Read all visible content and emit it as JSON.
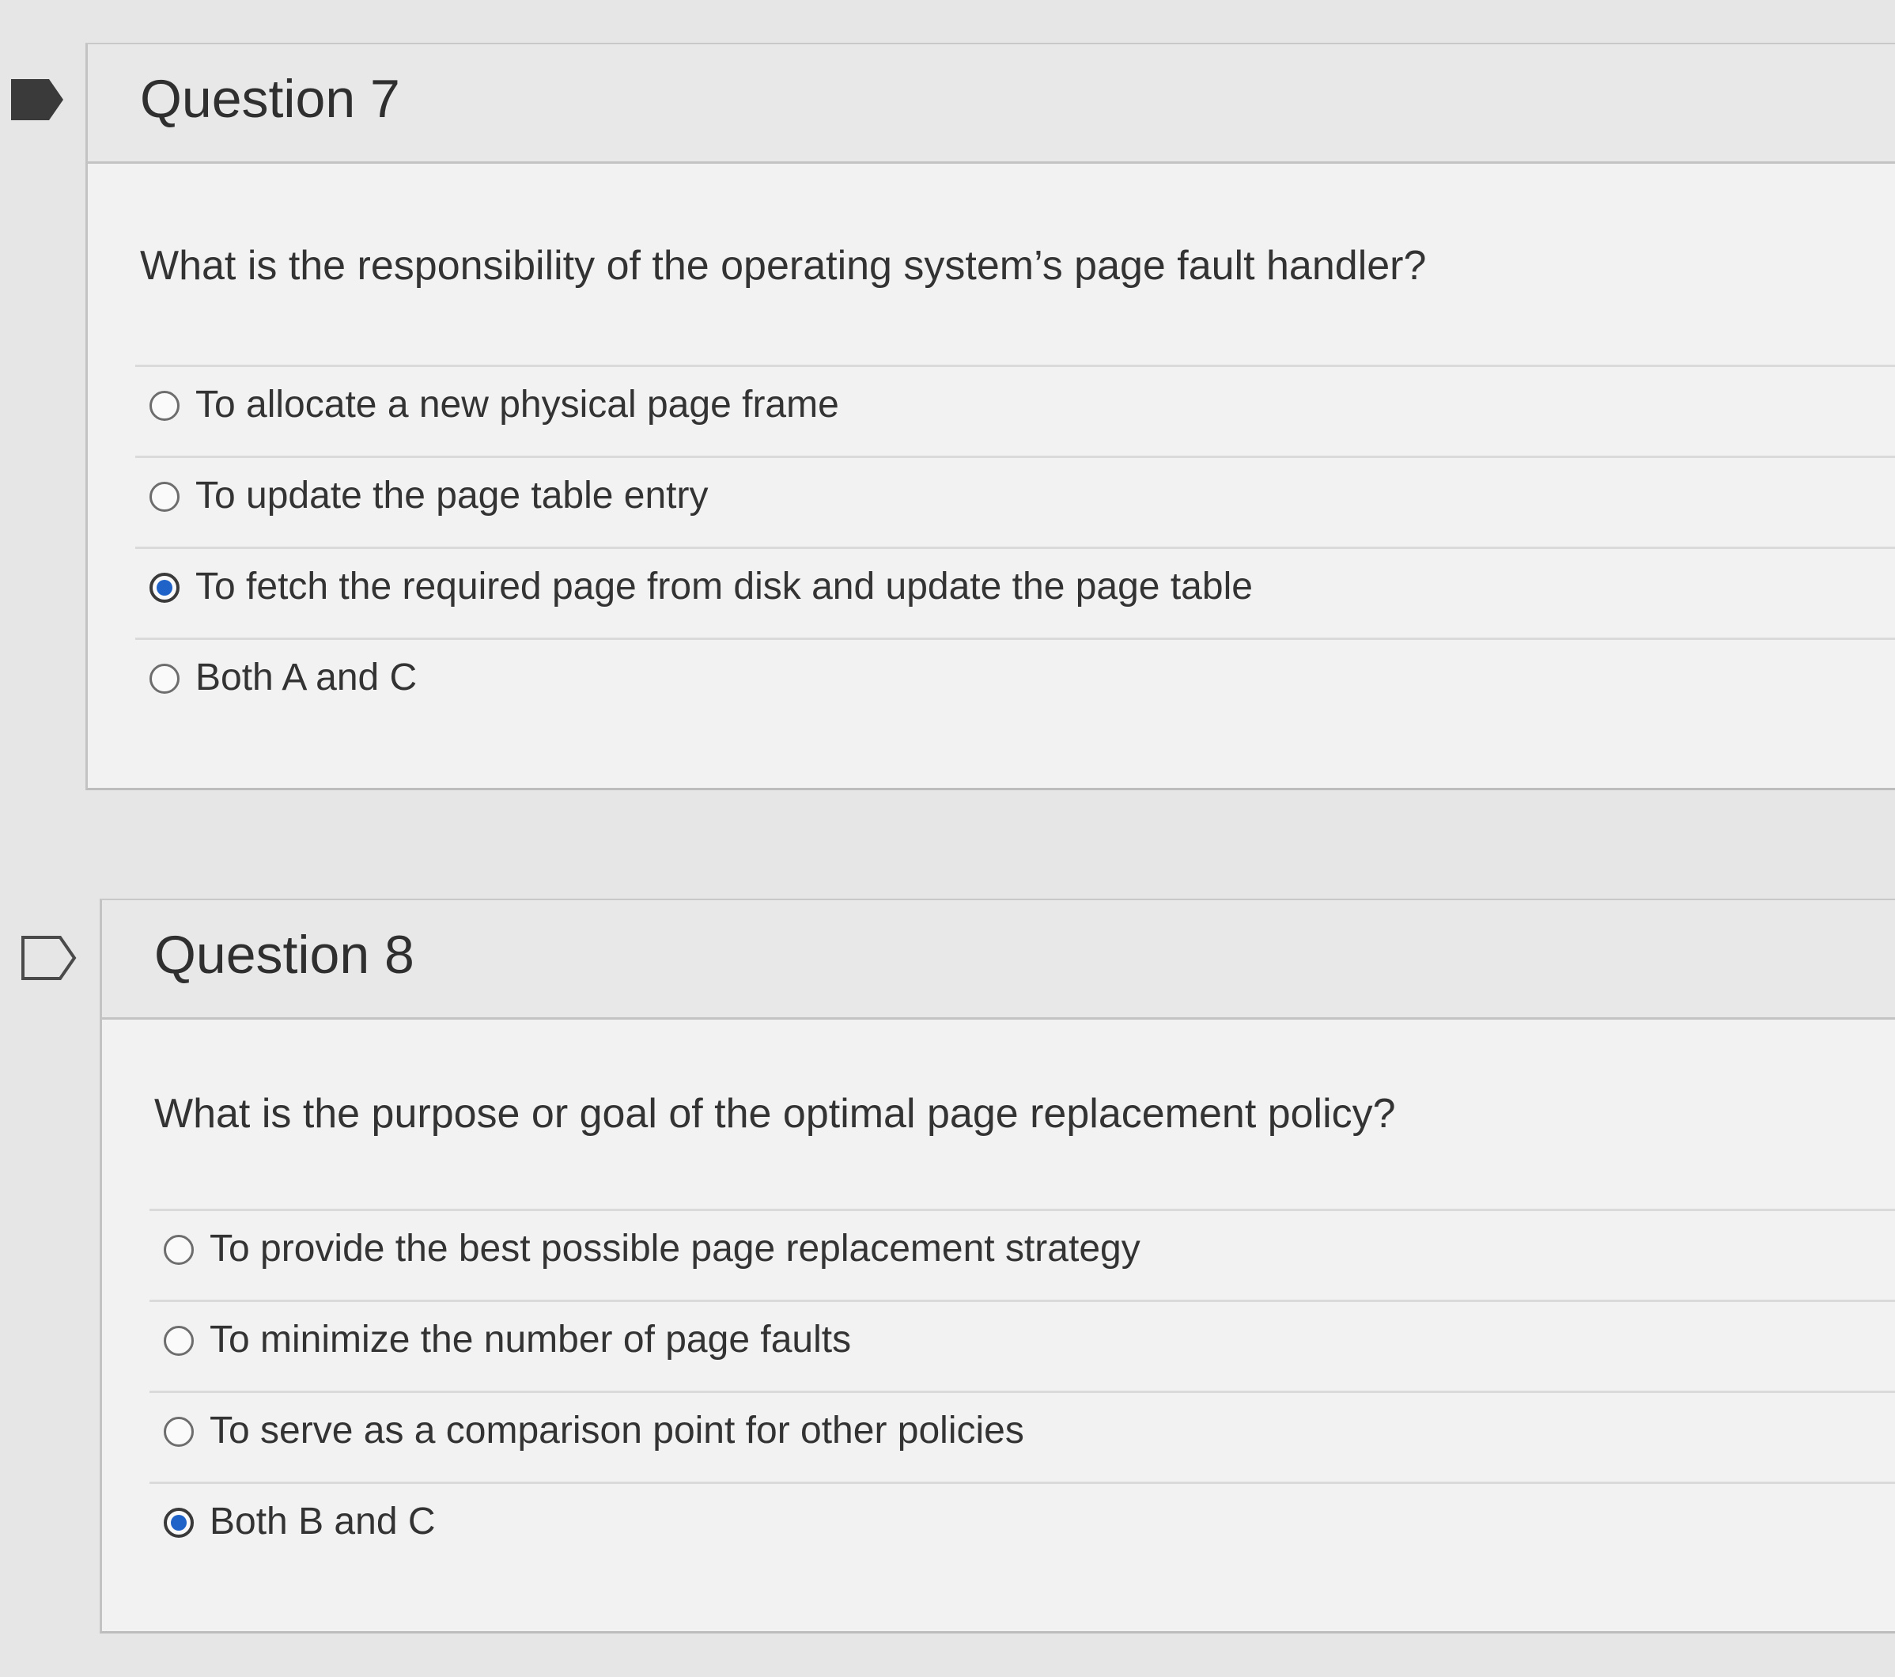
{
  "questions": [
    {
      "title": "Question 7",
      "flagged": true,
      "text": "What is the responsibility of the operating system’s page fault handler?",
      "options": [
        {
          "label": "To allocate a new physical page frame",
          "selected": false
        },
        {
          "label": "To update the page table entry",
          "selected": false
        },
        {
          "label": "To fetch the required page from disk and update the page table",
          "selected": true
        },
        {
          "label": "Both A and C",
          "selected": false
        }
      ]
    },
    {
      "title": "Question 8",
      "flagged": false,
      "text": "What is the purpose or goal of the optimal page replacement policy?",
      "options": [
        {
          "label": "To provide the best possible page replacement strategy",
          "selected": false
        },
        {
          "label": "To minimize the number of page faults",
          "selected": false
        },
        {
          "label": "To serve as a comparison point for other policies",
          "selected": false
        },
        {
          "label": "Both B and C",
          "selected": true
        }
      ]
    }
  ],
  "colors": {
    "radio_selected": "#1f63c9",
    "flag_filled": "#3a3a3a"
  },
  "icons": {
    "flagged": "flag-filled-icon",
    "unflagged": "flag-outline-icon"
  }
}
